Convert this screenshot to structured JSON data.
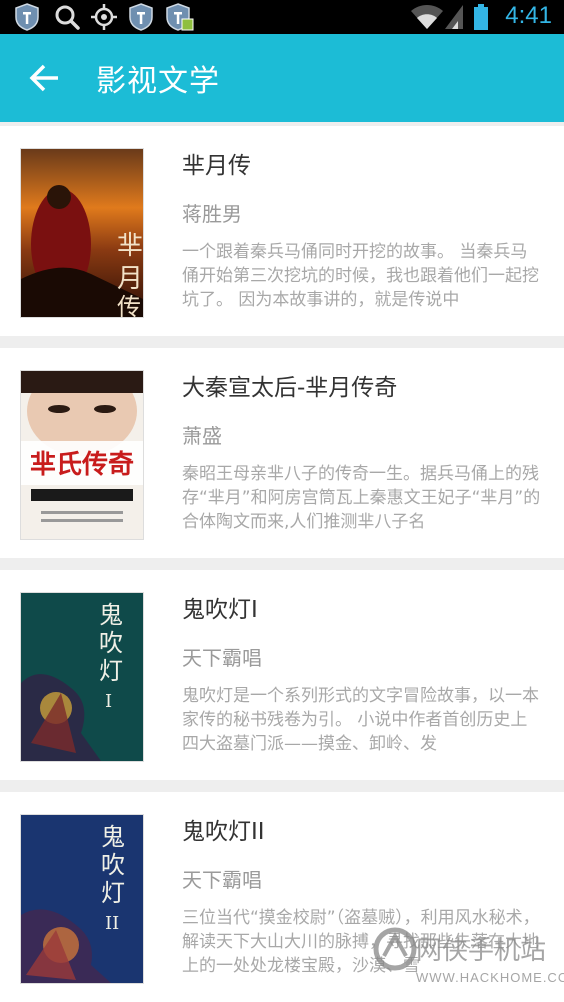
{
  "status_bar": {
    "time": "4:41",
    "icons": [
      "shield-icon",
      "search-icon",
      "gps-icon",
      "shield-icon",
      "shield-store-icon",
      "wifi-icon",
      "signal-icon",
      "battery-icon"
    ]
  },
  "app_bar": {
    "title": "影视文学",
    "back_icon": "arrow-left-icon",
    "color": "#1cbcd6"
  },
  "books": [
    {
      "title": "芈月传",
      "author": "蒋胜男",
      "description": "一个跟着秦兵马俑同时开挖的故事。 当秦兵马俑开始第三次挖坑的时候，我也跟着他们一起挖坑了。 因为本故事讲的，就是传说中",
      "cover_text": "芈月传"
    },
    {
      "title": "大秦宣太后-芈月传奇",
      "author": "萧盛",
      "description": "秦昭王母亲芈八子的传奇一生。据兵马俑上的残存“芈月”和阿房宫筒瓦上秦惠文王妃子“芈月”的合体陶文而来,人们推测芈八子名",
      "cover_text": "芈氏传奇"
    },
    {
      "title": "鬼吹灯I",
      "author": "天下霸唱",
      "description": "鬼吹灯是一个系列形式的文字冒险故事，以一本家传的秘书残卷为引。 小说中作者首创历史上四大盗墓门派——摸金、卸岭、发",
      "cover_text": "鬼吹灯 I"
    },
    {
      "title": "鬼吹灯II",
      "author": "天下霸唱",
      "description": "三位当代“摸金校尉”（盗墓贼），利用风水秘术，解读天下大山大川的脉搏，寻找那些失落在大地上的一处处龙楼宝殿，沙漠、雪",
      "cover_text": "鬼吹灯 II"
    }
  ],
  "watermark": {
    "name": "网侠手机站",
    "url": "WWW.HACKHOME.COM"
  }
}
